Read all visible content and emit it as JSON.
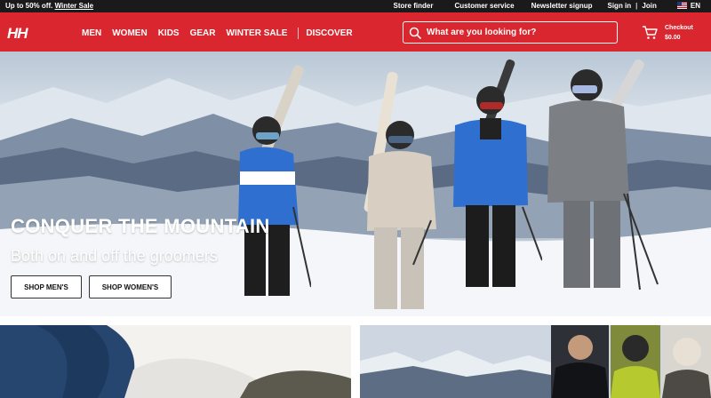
{
  "topbar": {
    "promo_text": "Up to 50% off.",
    "promo_link": "Winter Sale",
    "links": [
      "Store finder",
      "Customer service",
      "Newsletter signup",
      "Sign in",
      "Join"
    ],
    "separator": "|",
    "language": "EN"
  },
  "header": {
    "logo": "HH",
    "nav": [
      "MEN",
      "WOMEN",
      "KIDS",
      "GEAR",
      "WINTER SALE",
      "DISCOVER"
    ],
    "search_placeholder": "What are you looking for?",
    "cart": {
      "label": "Checkout",
      "amount": "$0.00"
    }
  },
  "hero": {
    "title": "CONQUER THE MOUNTAIN",
    "subtitle": "Both on and off the groomers",
    "buttons": [
      "SHOP MEN'S",
      "SHOP WOMEN'S"
    ]
  },
  "colors": {
    "brand_red": "#da262f",
    "topbar_bg": "#1a1a1a",
    "jacket_blue": "#2f6fd0",
    "jacket_beige": "#d8cfc2",
    "jacket_grey": "#7c7f84"
  },
  "icons": [
    "search-icon",
    "cart-icon",
    "us-flag-icon"
  ]
}
